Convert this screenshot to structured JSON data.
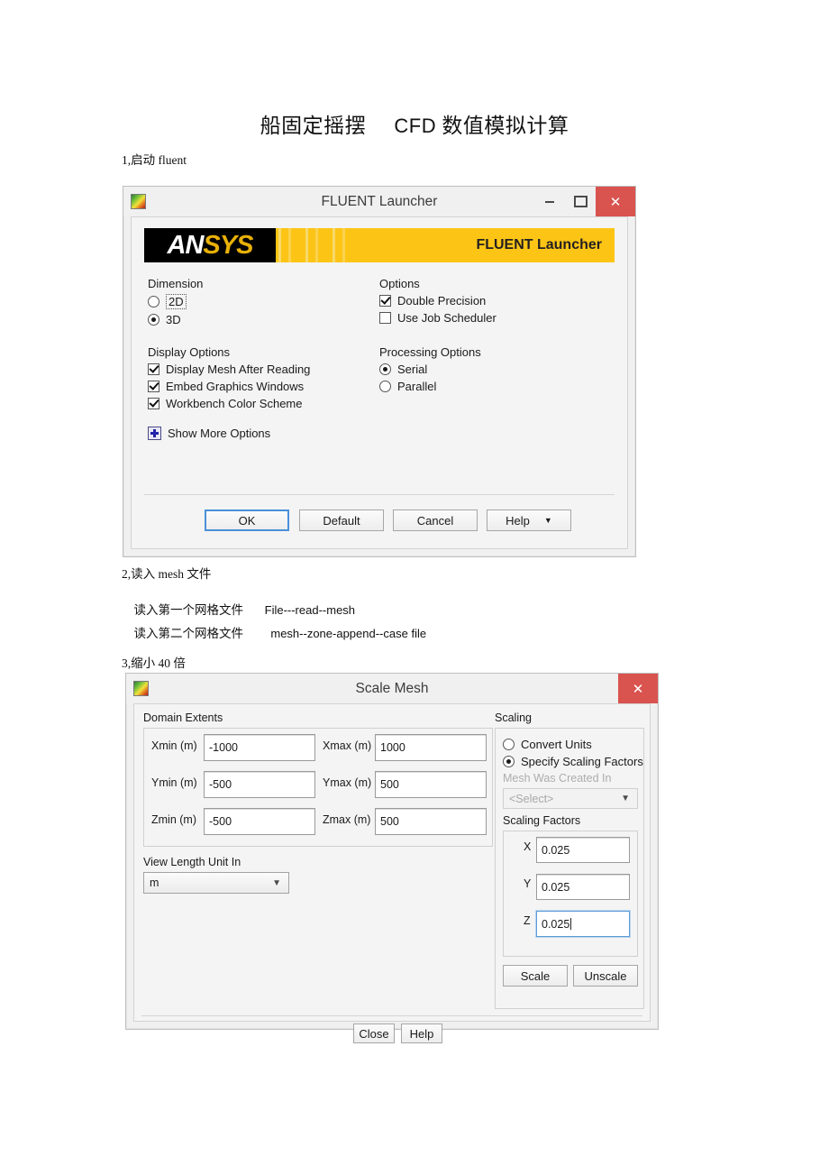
{
  "document": {
    "title_cn_1": "船固定摇摆",
    "title_lat": "CFD",
    "title_cn_2": "数值模拟计算",
    "step1": "1,启动 fluent",
    "step2": "2,读入 mesh 文件",
    "step2_line_a_label": "读入第一个网格文件",
    "step2_line_a_value": "File---read--mesh",
    "step2_line_b_label": "读入第二个网格文件",
    "step2_line_b_value": "mesh--zone-append--case file",
    "step3": "3,缩小 40 倍"
  },
  "launcher": {
    "window_title": "FLUENT Launcher",
    "banner_logo_an": "AN",
    "banner_logo_sys": "SYS",
    "banner_label": "FLUENT Launcher",
    "dimension": {
      "group_label": "Dimension",
      "options": [
        {
          "label": "2D",
          "selected": false,
          "focused": true
        },
        {
          "label": "3D",
          "selected": true,
          "focused": false
        }
      ]
    },
    "options": {
      "group_label": "Options",
      "items": [
        {
          "label": "Double Precision",
          "checked": true
        },
        {
          "label": "Use Job Scheduler",
          "checked": false
        }
      ]
    },
    "display_options": {
      "group_label": "Display Options",
      "items": [
        {
          "label": "Display Mesh After Reading",
          "checked": true
        },
        {
          "label": "Embed Graphics Windows",
          "checked": true
        },
        {
          "label": "Workbench Color Scheme",
          "checked": true
        }
      ]
    },
    "processing_options": {
      "group_label": "Processing Options",
      "items": [
        {
          "label": "Serial",
          "selected": true
        },
        {
          "label": "Parallel",
          "selected": false
        }
      ]
    },
    "show_more": "Show More Options",
    "buttons": {
      "ok": "OK",
      "default": "Default",
      "cancel": "Cancel",
      "help": "Help"
    },
    "titlebar_icons": {
      "minimize": "minimize-icon",
      "maximize": "maximize-icon",
      "close": "✕"
    }
  },
  "scale_mesh": {
    "window_title": "Scale Mesh",
    "close_glyph": "✕",
    "domain_extents": {
      "group_label": "Domain Extents",
      "rows": [
        {
          "min_label": "Xmin (m)",
          "min_value": "-1000",
          "max_label": "Xmax (m)",
          "max_value": "1000"
        },
        {
          "min_label": "Ymin (m)",
          "min_value": "-500",
          "max_label": "Ymax (m)",
          "max_value": "500"
        },
        {
          "min_label": "Zmin (m)",
          "min_value": "-500",
          "max_label": "Zmax (m)",
          "max_value": "500"
        }
      ]
    },
    "view_length_unit": {
      "label": "View Length Unit In",
      "value": "m"
    },
    "scaling": {
      "group_label": "Scaling",
      "convert_units": {
        "label": "Convert Units",
        "selected": false
      },
      "specify_factors": {
        "label": "Specify Scaling Factors",
        "selected": true
      },
      "mesh_created_in_label": "Mesh Was Created In",
      "mesh_created_in_value": "<Select>",
      "factors_label": "Scaling Factors",
      "factors": [
        {
          "axis": "X",
          "value": "0.025",
          "focused": false
        },
        {
          "axis": "Y",
          "value": "0.025",
          "focused": false
        },
        {
          "axis": "Z",
          "value": "0.025",
          "focused": true
        }
      ],
      "scale_button": "Scale",
      "unscale_button": "Unscale"
    },
    "buttons": {
      "close": "Close",
      "help": "Help"
    }
  },
  "colors": {
    "ansys_gold": "#fcc516",
    "close_red": "#d9534f",
    "focus_blue": "#4a90d9",
    "dialog_bg": "#f0f0f0"
  }
}
